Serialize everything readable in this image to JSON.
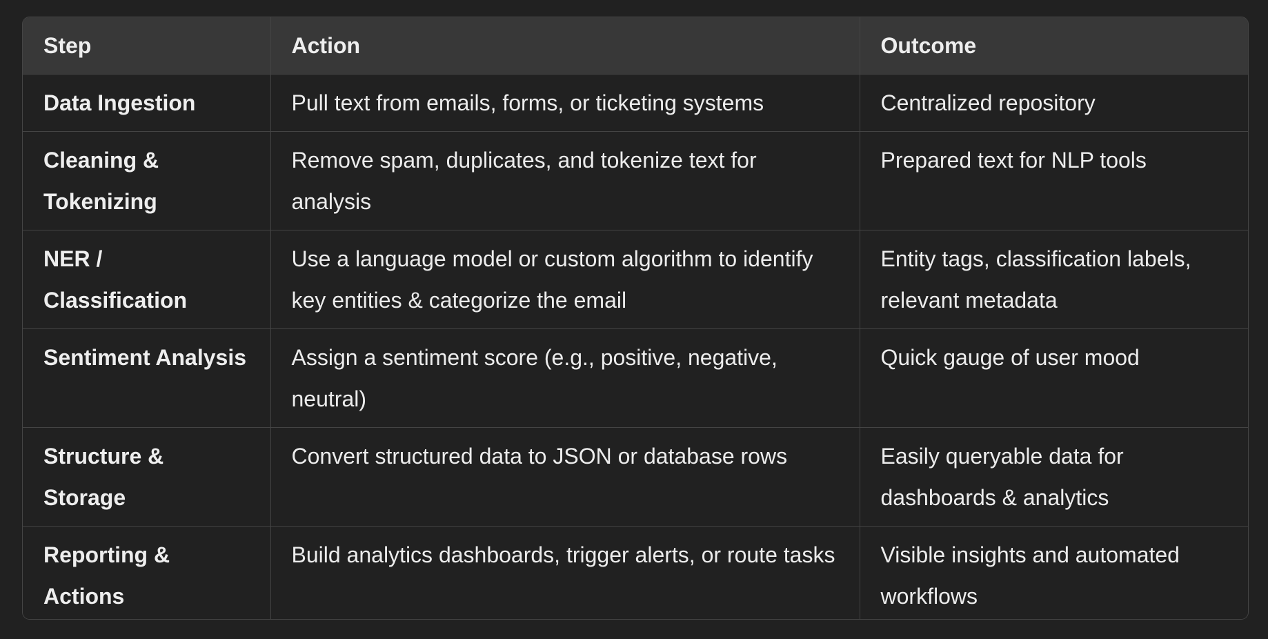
{
  "table": {
    "headers": [
      "Step",
      "Action",
      "Outcome"
    ],
    "rows": [
      {
        "step": "Data Ingestion",
        "action": "Pull text from emails, forms, or ticketing systems",
        "outcome": "Centralized repository"
      },
      {
        "step": "Cleaning & Tokenizing",
        "action": "Remove spam, duplicates, and tokenize text for analysis",
        "outcome": "Prepared text for NLP tools"
      },
      {
        "step": "NER / Classification",
        "action": "Use a language model or custom algorithm to identify key entities & categorize the email",
        "outcome": "Entity tags, classification labels, relevant metadata"
      },
      {
        "step": "Sentiment Analysis",
        "action": "Assign a sentiment score (e.g., positive, negative, neutral)",
        "outcome": "Quick gauge of user mood"
      },
      {
        "step": "Structure & Storage",
        "action": "Convert structured data to JSON or database rows",
        "outcome": "Easily queryable data for dashboards & analytics"
      },
      {
        "step": "Reporting & Actions",
        "action": "Build analytics dashboards, trigger alerts, or route tasks",
        "outcome": "Visible insights and automated workflows"
      }
    ]
  },
  "colors": {
    "page_background": "#212121",
    "header_background": "#383838",
    "border": "#444444",
    "text": "#ececec"
  }
}
